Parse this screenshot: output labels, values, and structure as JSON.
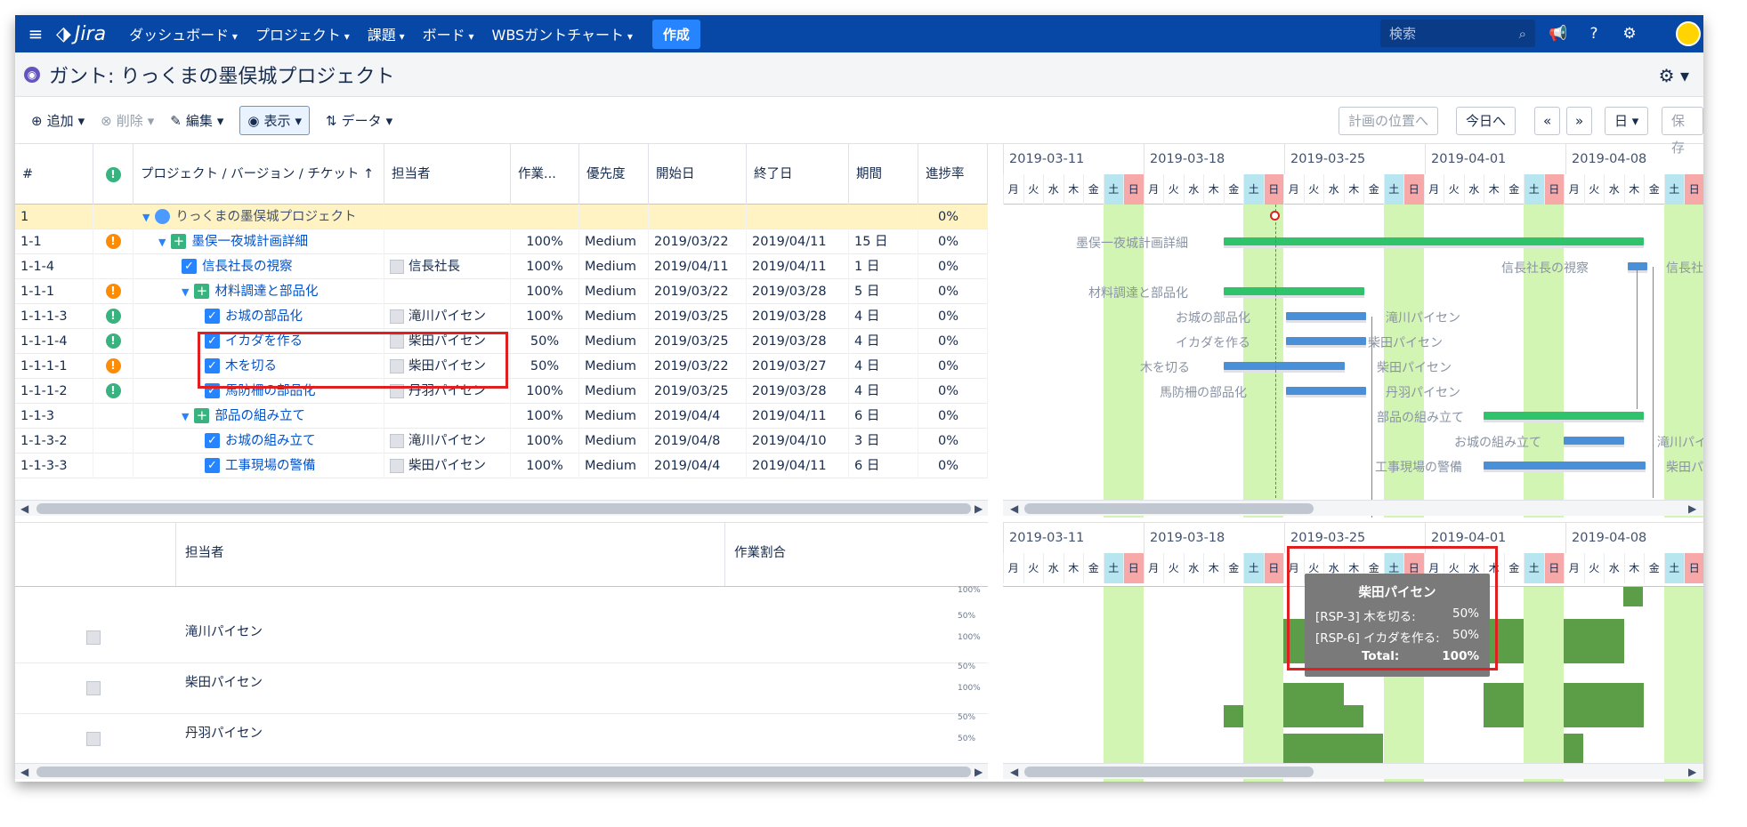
{
  "topnav": {
    "app": "Jira",
    "items": [
      "ダッシュボード",
      "プロジェクト",
      "課題",
      "ボード",
      "WBSガントチャート"
    ],
    "create": "作成",
    "search_placeholder": "検索"
  },
  "title": "ガント: りっくまの墨俣城プロジェクト",
  "toolbar": {
    "add": "追加",
    "delete": "削除",
    "edit": "編集",
    "view": "表示",
    "data": "データ",
    "plan_pos": "計画の位置へ",
    "today": "今日へ",
    "prev": "«",
    "next": "»",
    "unit": "日",
    "save": "保存"
  },
  "grid": {
    "headers": [
      "#",
      "!",
      "プロジェクト / バージョン / チケット ↑",
      "担当者",
      "作業...",
      "優先度",
      "開始日",
      "終了日",
      "期間",
      "進捗率"
    ],
    "rows": [
      {
        "id": "1",
        "name": "りっくまの墨俣城プロジェクト",
        "assignee": "",
        "work": "",
        "priority": "",
        "start": "",
        "end": "",
        "dur": "",
        "prog": "0%",
        "type": "project",
        "pri_icon": "",
        "indent": 0
      },
      {
        "id": "1-1",
        "name": "墨俣一夜城計画詳細",
        "assignee": "",
        "work": "100%",
        "priority": "Medium",
        "start": "2019/03/22",
        "end": "2019/04/11",
        "dur": "15 日",
        "prog": "0%",
        "type": "epic",
        "pri_icon": "o",
        "indent": 1
      },
      {
        "id": "1-1-4",
        "name": "信長社長の視察",
        "assignee": "信長社長",
        "work": "100%",
        "priority": "Medium",
        "start": "2019/04/11",
        "end": "2019/04/11",
        "dur": "1 日",
        "prog": "0%",
        "type": "task",
        "pri_icon": "",
        "indent": 2
      },
      {
        "id": "1-1-1",
        "name": "材料調達と部品化",
        "assignee": "",
        "work": "100%",
        "priority": "Medium",
        "start": "2019/03/22",
        "end": "2019/03/28",
        "dur": "5 日",
        "prog": "0%",
        "type": "epic",
        "pri_icon": "o",
        "indent": 2
      },
      {
        "id": "1-1-1-3",
        "name": "お城の部品化",
        "assignee": "滝川パイセン",
        "work": "100%",
        "priority": "Medium",
        "start": "2019/03/25",
        "end": "2019/03/28",
        "dur": "4 日",
        "prog": "0%",
        "type": "task",
        "pri_icon": "g",
        "indent": 3
      },
      {
        "id": "1-1-1-4",
        "name": "イカダを作る",
        "assignee": "柴田パイセン",
        "work": "50%",
        "priority": "Medium",
        "start": "2019/03/25",
        "end": "2019/03/28",
        "dur": "4 日",
        "prog": "0%",
        "type": "task",
        "pri_icon": "g",
        "indent": 3
      },
      {
        "id": "1-1-1-1",
        "name": "木を切る",
        "assignee": "柴田パイセン",
        "work": "50%",
        "priority": "Medium",
        "start": "2019/03/22",
        "end": "2019/03/27",
        "dur": "4 日",
        "prog": "0%",
        "type": "task",
        "pri_icon": "o",
        "indent": 3
      },
      {
        "id": "1-1-1-2",
        "name": "馬防柵の部品化",
        "assignee": "丹羽パイセン",
        "work": "100%",
        "priority": "Medium",
        "start": "2019/03/25",
        "end": "2019/03/28",
        "dur": "4 日",
        "prog": "0%",
        "type": "task",
        "pri_icon": "g",
        "indent": 3
      },
      {
        "id": "1-1-3",
        "name": "部品の組み立て",
        "assignee": "",
        "work": "100%",
        "priority": "Medium",
        "start": "2019/04/4",
        "end": "2019/04/11",
        "dur": "6 日",
        "prog": "0%",
        "type": "epic",
        "pri_icon": "",
        "indent": 2
      },
      {
        "id": "1-1-3-2",
        "name": "お城の組み立て",
        "assignee": "滝川パイセン",
        "work": "100%",
        "priority": "Medium",
        "start": "2019/04/8",
        "end": "2019/04/10",
        "dur": "3 日",
        "prog": "0%",
        "type": "task",
        "pri_icon": "",
        "indent": 3
      },
      {
        "id": "1-1-3-3",
        "name": "工事現場の警備",
        "assignee": "柴田パイセン",
        "work": "100%",
        "priority": "Medium",
        "start": "2019/04/4",
        "end": "2019/04/11",
        "dur": "6 日",
        "prog": "0%",
        "type": "task",
        "pri_icon": "",
        "indent": 3
      }
    ]
  },
  "gantt": {
    "weeks": [
      "2019-03-11",
      "2019-03-18",
      "2019-03-25",
      "2019-04-01",
      "2019-04-08"
    ],
    "days": [
      "月",
      "火",
      "水",
      "木",
      "金",
      "土",
      "日"
    ],
    "bar_labels": [
      "墨俣一夜城計画詳細",
      "信長社長の視察",
      "信長社",
      "材料調達と部品化",
      "お城の部品化",
      "滝川パイセン",
      "イカダを作る",
      "柴田パイセン",
      "木を切る",
      "柴田パイセン",
      "馬防柵の部品化",
      "丹羽パイセン",
      "部品の組み立て",
      "お城の組み立て",
      "滝川パイ†",
      "工事現場の警備",
      "柴田パ"
    ]
  },
  "resources": {
    "headers": [
      "担当者",
      "作業割合"
    ],
    "rows": [
      {
        "name": "滝川パイセン"
      },
      {
        "name": "柴田パイセン"
      },
      {
        "name": "丹羽パイセン"
      }
    ],
    "scale": [
      "100%",
      "50%",
      "100%",
      "50%",
      "100%",
      "50%",
      "50%"
    ]
  },
  "tooltip": {
    "title": "柴田パイセン",
    "lines": [
      {
        "k": "[RSP-3] 木を切る:",
        "v": "50%"
      },
      {
        "k": "[RSP-6] イカダを作る:",
        "v": "50%"
      }
    ],
    "total_k": "Total:",
    "total_v": "100%"
  }
}
